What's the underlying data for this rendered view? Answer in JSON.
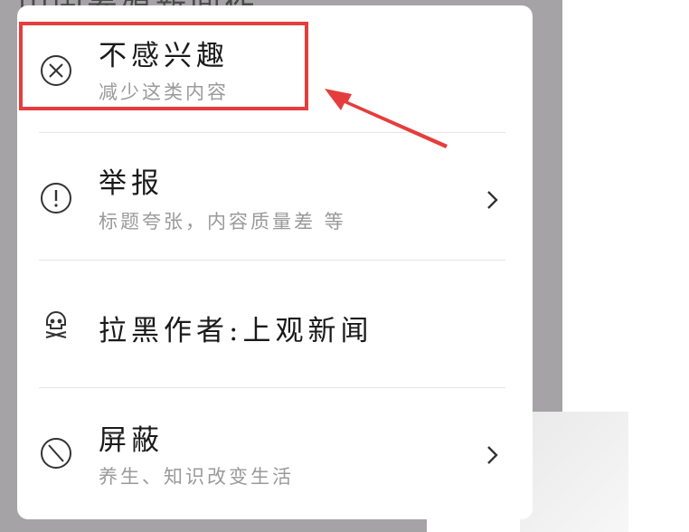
{
  "background": {
    "title": "中国养殖新闻作"
  },
  "menu": {
    "items": [
      {
        "title": "不感兴趣",
        "subtitle": "减少这类内容",
        "icon": "close-circle-icon"
      },
      {
        "title": "举报",
        "subtitle": "标题夸张，内容质量差 等",
        "icon": "exclamation-circle-icon",
        "chevron": true
      },
      {
        "title": "拉黑作者:上观新闻",
        "icon": "skull-icon"
      },
      {
        "title": "屏蔽",
        "subtitle": "养生、知识改变生活",
        "icon": "block-circle-icon",
        "chevron": true
      }
    ]
  },
  "colors": {
    "highlight": "#e53d3d",
    "backdrop": "#a5a3a5"
  }
}
